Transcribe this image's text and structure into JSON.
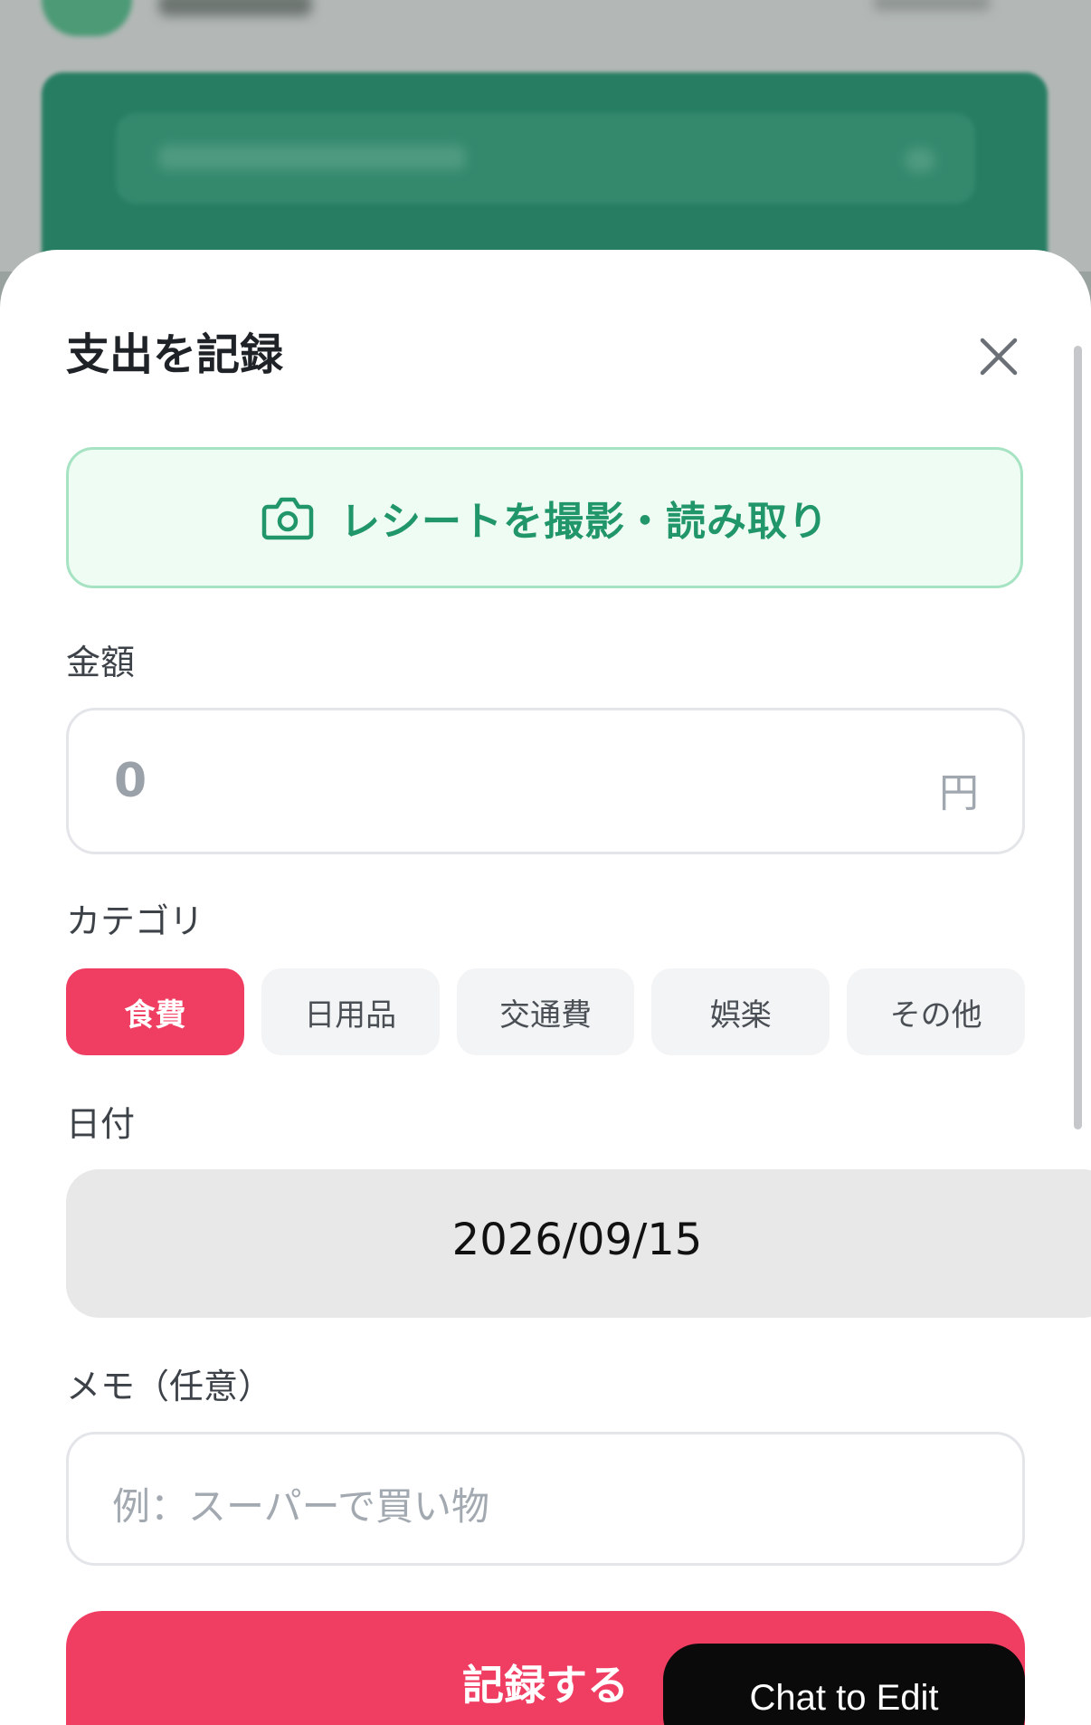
{
  "sheet": {
    "title": "支出を記録",
    "close_icon": "close-icon"
  },
  "receipt": {
    "label": "レシートを撮影・読み取り",
    "icon": "camera-icon"
  },
  "amount": {
    "label": "金額",
    "placeholder": "0",
    "unit": "円"
  },
  "category": {
    "label": "カテゴリ",
    "items": [
      {
        "label": "食費",
        "selected": true
      },
      {
        "label": "日用品",
        "selected": false
      },
      {
        "label": "交通費",
        "selected": false
      },
      {
        "label": "娯楽",
        "selected": false
      },
      {
        "label": "その他",
        "selected": false
      }
    ]
  },
  "date": {
    "label": "日付",
    "value": "2026/09/15"
  },
  "memo": {
    "label": "メモ（任意）",
    "placeholder": "例：スーパーで買い物"
  },
  "submit": {
    "label": "記録する"
  },
  "chat_to_edit": {
    "label": "Chat to Edit"
  },
  "colors": {
    "accent": "#f03d62",
    "receipt_green": "#21966a",
    "receipt_bg": "#effcf4",
    "background_card": "#267d62"
  }
}
